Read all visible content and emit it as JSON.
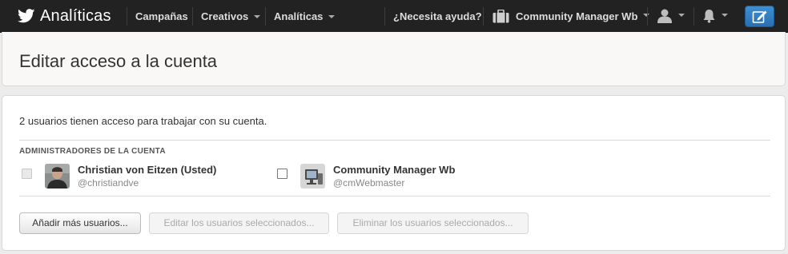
{
  "nav": {
    "brand": "Analíticas",
    "items": [
      {
        "label": "Campañas"
      },
      {
        "label": "Creativos"
      },
      {
        "label": "Analíticas"
      }
    ],
    "help": "¿Necesita ayuda?",
    "account": "Community Manager Wb",
    "icons": [
      "twitter-bird-icon",
      "briefcase-icon",
      "user-icon",
      "bell-icon",
      "compose-icon"
    ]
  },
  "page": {
    "title": "Editar acceso a la cuenta",
    "summary": "2 usuarios tienen acceso para trabajar con su cuenta.",
    "section_label": "ADMINISTRADORES DE LA CUENTA"
  },
  "users": [
    {
      "name": "Christian von Eitzen (Usted)",
      "handle": "@christiandve",
      "checkbox_disabled": true
    },
    {
      "name": "Community Manager Wb",
      "handle": "@cmWebmaster",
      "checkbox_disabled": false
    }
  ],
  "actions": {
    "add": "Añadir más usuarios...",
    "edit": "Editar los usuarios seleccionados...",
    "remove": "Eliminar los usuarios seleccionados..."
  },
  "colors": {
    "topbar": "#222222",
    "compose_button": "#2f7bc1"
  }
}
